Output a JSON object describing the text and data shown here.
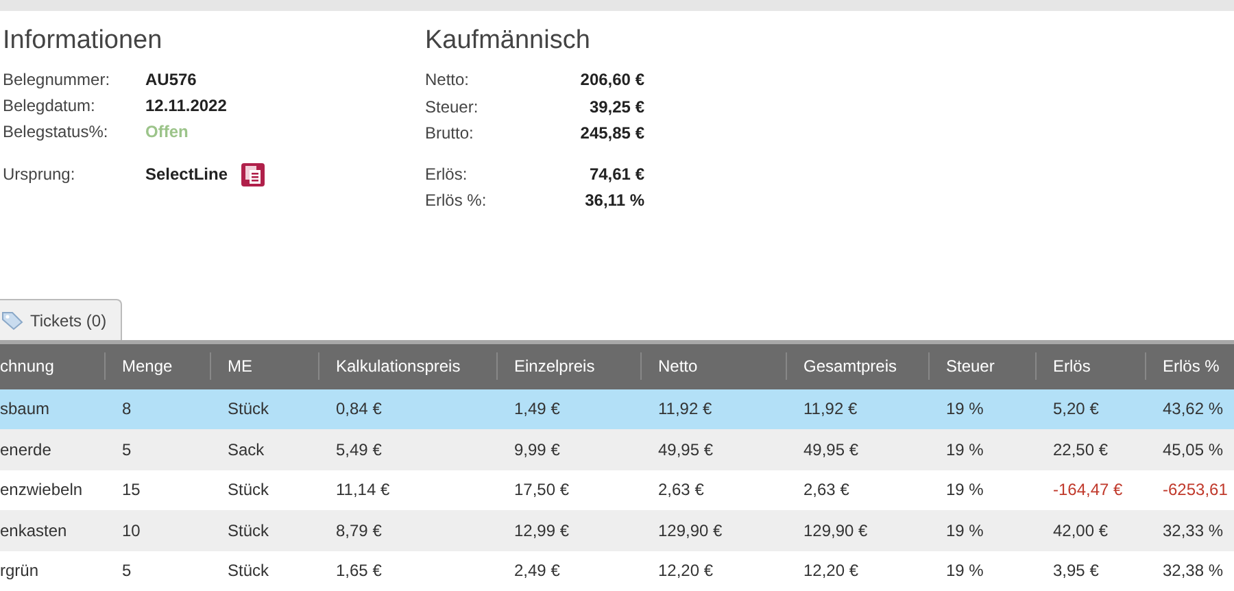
{
  "informationen": {
    "title": "Informationen",
    "fields": [
      {
        "label": "Belegnummer:",
        "value": "AU576",
        "kind": "text"
      },
      {
        "label": "Belegdatum:",
        "value": "12.11.2022",
        "kind": "text"
      },
      {
        "label": "Belegstatus%:",
        "value": "Offen",
        "kind": "status"
      },
      {
        "label": "Ursprung:",
        "value": "SelectLine",
        "kind": "source"
      }
    ]
  },
  "kaufmaennisch": {
    "title": "Kaufmännisch",
    "fields": [
      {
        "label": "Netto:",
        "value": "206,60 €"
      },
      {
        "label": "Steuer:",
        "value": "39,25 €"
      },
      {
        "label": "Brutto:",
        "value": "245,85 €"
      },
      {
        "label": "Erlös:",
        "value": "74,61 €"
      },
      {
        "label": "Erlös %:",
        "value": "36,11 %"
      }
    ]
  },
  "tabs": [
    {
      "label": "Tickets (0)",
      "selected": true
    }
  ],
  "table": {
    "columns": [
      "chnung",
      "Menge",
      "ME",
      "Kalkulationspreis",
      "Einzelpreis",
      "Netto",
      "Gesamtpreis",
      "Steuer",
      "Erlös",
      "Erlös %"
    ],
    "rows": [
      {
        "selected": true,
        "loss": false,
        "cells": [
          "sbaum",
          "8",
          "Stück",
          "0,84 €",
          "1,49 €",
          "11,92 €",
          "11,92 €",
          "19 %",
          "5,20 €",
          "43,62 %"
        ]
      },
      {
        "selected": false,
        "loss": false,
        "cells": [
          "enerde",
          "5",
          "Sack",
          "5,49 €",
          "9,99 €",
          "49,95 €",
          "49,95 €",
          "19 %",
          "22,50 €",
          "45,05 %"
        ]
      },
      {
        "selected": false,
        "loss": true,
        "cells": [
          "enzwiebeln",
          "15",
          "Stück",
          "11,14 €",
          "17,50 €",
          "2,63 €",
          "2,63 €",
          "19 %",
          "-164,47 €",
          "-6253,61"
        ]
      },
      {
        "selected": false,
        "loss": false,
        "cells": [
          "enkasten",
          "10",
          "Stück",
          "8,79 €",
          "12,99 €",
          "129,90 €",
          "129,90 €",
          "19 %",
          "42,00 €",
          "32,33 %"
        ]
      },
      {
        "selected": false,
        "loss": false,
        "cells": [
          "rgrün",
          "5",
          "Stück",
          "1,65 €",
          "2,49 €",
          "12,20 €",
          "12,20 €",
          "19 %",
          "3,95 €",
          "32,38 %"
        ]
      }
    ]
  }
}
